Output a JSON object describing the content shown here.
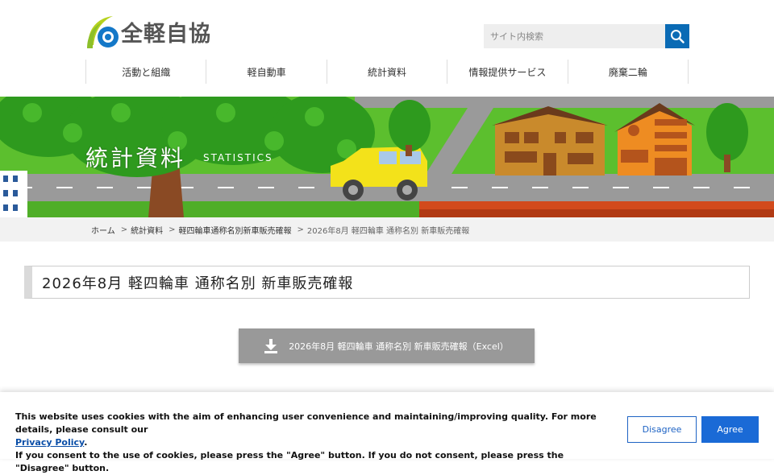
{
  "header": {
    "logo_text": "全軽自協",
    "search": {
      "placeholder": "サイト内検索"
    },
    "nav": [
      {
        "label": "活動と組織"
      },
      {
        "label": "軽自動車"
      },
      {
        "label": "統計資料"
      },
      {
        "label": "情報提供サービス"
      },
      {
        "label": "廃棄二輪"
      }
    ]
  },
  "banner": {
    "title": "統計資料",
    "subtitle": "STATISTICS"
  },
  "breadcrumb": {
    "items": [
      {
        "label": "ホーム"
      },
      {
        "label": "統計資料"
      },
      {
        "label": "軽四輪車通称名別新車販売確報"
      }
    ],
    "current": "2026年8月 軽四輪車 通称名別 新車販売確報"
  },
  "main": {
    "page_title": "2026年8月 軽四輪車 通称名別 新車販売確報",
    "download_label": "2026年8月 軽四輪車 通称名別 新車販売確報（Excel）"
  },
  "cookie": {
    "line1": "This website uses cookies with the aim of enhancing user convenience and maintaining/improving quality. For more details, please consult our",
    "policy_link": "Privacy Policy",
    "line2_suffix": ".",
    "line3": "If you consent to the use of cookies, please press the \"Agree\" button. If you do not consent, please press the \"Disagree\" button.",
    "disagree_label": "Disagree",
    "agree_label": "Agree"
  },
  "colors": {
    "accent_blue": "#0a6bb5",
    "agree_blue": "#1a6ad6",
    "download_gray": "#999999",
    "breadcrumb_bg": "#f2f2f2"
  }
}
